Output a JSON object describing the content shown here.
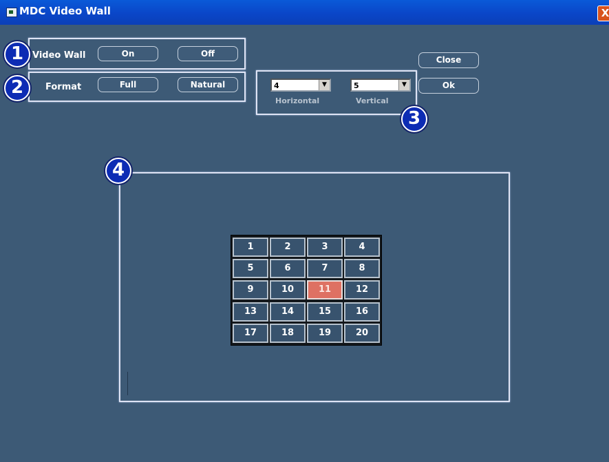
{
  "window": {
    "title": "MDC Video Wall",
    "close_glyph": "X"
  },
  "badges": [
    "1",
    "2",
    "3",
    "4"
  ],
  "video_wall": {
    "label": "Video Wall",
    "on_label": "On",
    "off_label": "Off"
  },
  "format": {
    "label": "Format",
    "full_label": "Full",
    "natural_label": "Natural"
  },
  "dimensions": {
    "horizontal": {
      "value": "4",
      "label": "Horizontal"
    },
    "vertical": {
      "value": "5",
      "label": "Vertical"
    }
  },
  "actions": {
    "close_label": "Close",
    "ok_label": "Ok"
  },
  "grid": {
    "cells": [
      [
        "1",
        "2",
        "3",
        "4"
      ],
      [
        "5",
        "6",
        "7",
        "8"
      ],
      [
        "9",
        "10",
        "11",
        "12"
      ],
      [
        "13",
        "14",
        "15",
        "16"
      ],
      [
        "17",
        "18",
        "19",
        "20"
      ]
    ],
    "selected": "11",
    "selected_color": "#de7163"
  }
}
